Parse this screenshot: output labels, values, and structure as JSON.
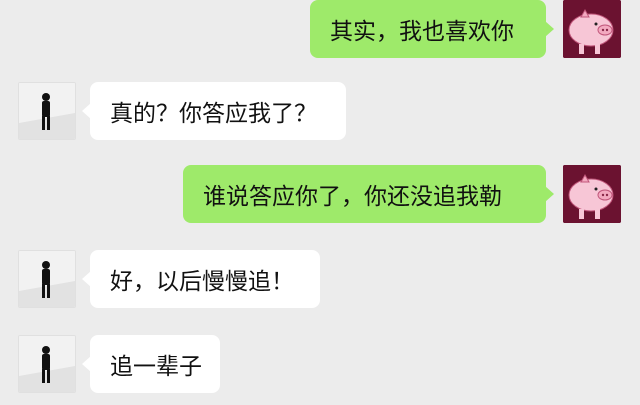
{
  "conversation": {
    "messages": [
      {
        "side": "out",
        "avatar": "pig-avatar-icon",
        "text": "其实，我也喜欢你"
      },
      {
        "side": "in",
        "avatar": "person-avatar-icon",
        "text": "真的？你答应我了？"
      },
      {
        "side": "out",
        "avatar": "pig-avatar-icon",
        "text": "谁说答应你了，你还没追我勒"
      },
      {
        "side": "in",
        "avatar": "person-avatar-icon",
        "text": "好，以后慢慢追！"
      },
      {
        "side": "in",
        "avatar": "person-avatar-icon",
        "text": "追一辈子"
      }
    ]
  },
  "colors": {
    "background": "#ececec",
    "outgoing_bubble": "#9eea6a",
    "incoming_bubble": "#ffffff",
    "pig_avatar_bg": "#6b1230"
  }
}
